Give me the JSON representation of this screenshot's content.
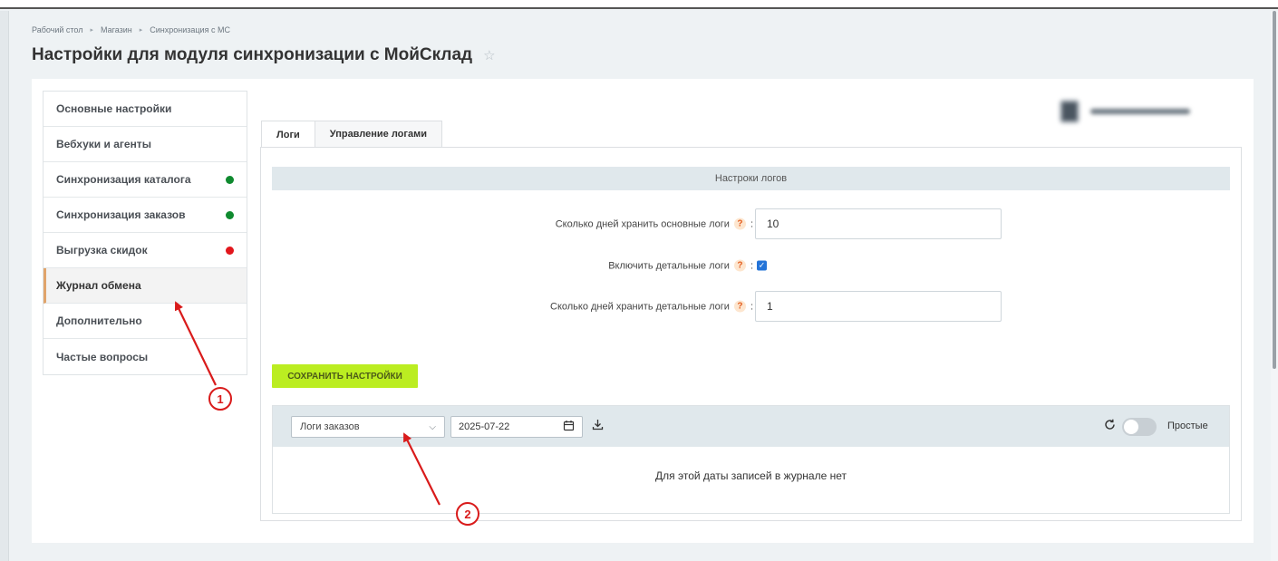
{
  "breadcrumb": [
    "Рабочий стол",
    "Магазин",
    "Синхронизация с МС"
  ],
  "page_title": "Настройки для модуля синхронизации с МойСклад",
  "sidebar": {
    "items": [
      {
        "label": "Основные настройки",
        "status": ""
      },
      {
        "label": "Вебхуки и агенты",
        "status": ""
      },
      {
        "label": "Синхронизация каталога",
        "status": "green"
      },
      {
        "label": "Синхронизация заказов",
        "status": "green"
      },
      {
        "label": "Выгрузка скидок",
        "status": "red"
      },
      {
        "label": "Журнал обмена",
        "status": "",
        "active": true
      },
      {
        "label": "Дополнительно",
        "status": ""
      },
      {
        "label": "Частые вопросы",
        "status": ""
      }
    ]
  },
  "tabs": [
    {
      "label": "Логи",
      "active": true
    },
    {
      "label": "Управление логами",
      "active": false
    }
  ],
  "settings": {
    "header": "Настроки логов",
    "main_logs_days_label": "Сколько дней хранить основные логи",
    "main_logs_days_value": "10",
    "detailed_logs_label": "Включить детальные логи",
    "detailed_logs_checked": true,
    "detailed_logs_days_label": "Сколько дней хранить детальные логи",
    "detailed_logs_days_value": "1",
    "help_symbol": "?",
    "label_suffix": ":"
  },
  "save_button": "СОХРАНИТЬ НАСТРОЙКИ",
  "log_viewer": {
    "log_type": "Логи заказов",
    "date": "2025-07-22",
    "toggle_label": "Простые",
    "toggle_on": false,
    "empty_message": "Для этой даты записей в журнале нет"
  },
  "annotations": [
    {
      "label": "1",
      "color": "#d91b1b"
    },
    {
      "label": "2",
      "color": "#d91b1b"
    }
  ],
  "colors": {
    "status_green": "#0f8a2f",
    "status_red": "#e2161c",
    "save_button_bg": "#bbed21",
    "checkbox_blue": "#2474d8",
    "annotation_red": "#d91b1b"
  }
}
